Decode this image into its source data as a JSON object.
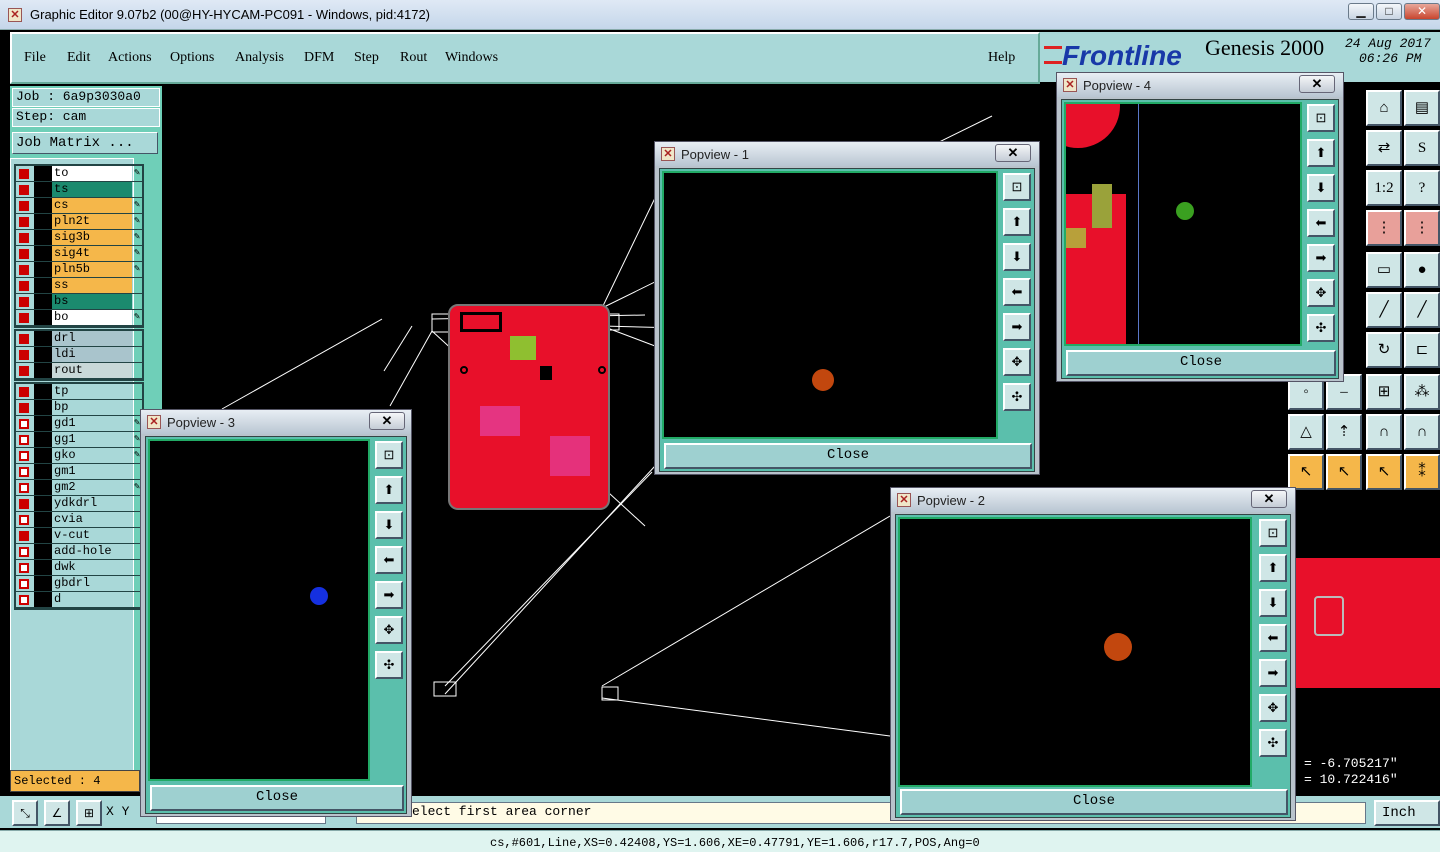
{
  "window": {
    "title": "Graphic Editor 9.07b2 (00@HY-HYCAM-PC091 - Windows, pid:4172)",
    "min": "▁",
    "max": "□",
    "close": "✕"
  },
  "menu": {
    "items": [
      "File",
      "Edit",
      "Actions",
      "Options",
      "Analysis",
      "DFM",
      "Step",
      "Rout",
      "Windows"
    ],
    "help": "Help"
  },
  "logo": {
    "brand": "Frontline",
    "product": "Genesis 2000",
    "date": "24 Aug 2017",
    "time": "06:26 PM"
  },
  "job": {
    "job_label": "Job : 6a9p3030a0",
    "step_label": "Step: cam",
    "matrix_button": "Job Matrix ..."
  },
  "layers_group1": [
    {
      "name": "to",
      "color": "#ffffff",
      "on": true,
      "pen": true
    },
    {
      "name": "ts",
      "color": "#1b8a6e",
      "on": true,
      "pen": false
    },
    {
      "name": "cs",
      "color": "#f5b74a",
      "on": true,
      "pen": true
    },
    {
      "name": "pln2t",
      "color": "#f5b74a",
      "on": true,
      "pen": true
    },
    {
      "name": "sig3b",
      "color": "#f5b74a",
      "on": true,
      "pen": true
    },
    {
      "name": "sig4t",
      "color": "#f5b74a",
      "on": true,
      "pen": true
    },
    {
      "name": "pln5b",
      "color": "#f5b74a",
      "on": true,
      "pen": true
    },
    {
      "name": "ss",
      "color": "#f5b74a",
      "on": true,
      "pen": false
    },
    {
      "name": "bs",
      "color": "#1b8a6e",
      "on": true,
      "pen": false
    },
    {
      "name": "bo",
      "color": "#ffffff",
      "on": true,
      "pen": true
    }
  ],
  "layers_group2": [
    {
      "name": "drl",
      "color": "#a9c4cc",
      "on": true,
      "pen": false
    },
    {
      "name": "ldi",
      "color": "#a9c4cc",
      "on": true,
      "pen": false
    },
    {
      "name": "rout",
      "color": "#c8d8d8",
      "on": true,
      "pen": false
    }
  ],
  "layers_group3": [
    {
      "name": "tp",
      "color": "#a9d8d8",
      "on": true,
      "pen": false
    },
    {
      "name": "bp",
      "color": "#a9d8d8",
      "on": true,
      "pen": false
    },
    {
      "name": "gd1",
      "color": "#a9d8d8",
      "on": false,
      "pen": true
    },
    {
      "name": "gg1",
      "color": "#a9d8d8",
      "on": false,
      "pen": true
    },
    {
      "name": "gko",
      "color": "#a9d8d8",
      "on": false,
      "pen": true
    },
    {
      "name": "gm1",
      "color": "#a9d8d8",
      "on": false,
      "pen": false
    },
    {
      "name": "gm2",
      "color": "#a9d8d8",
      "on": false,
      "pen": true
    },
    {
      "name": "ydkdrl",
      "color": "#a9d8d8",
      "on": true,
      "pen": false
    },
    {
      "name": "cvia",
      "color": "#a9d8d8",
      "on": false,
      "pen": false
    },
    {
      "name": "v-cut",
      "color": "#a9d8d8",
      "on": true,
      "pen": false
    },
    {
      "name": "add-hole",
      "color": "#a9d8d8",
      "on": false,
      "pen": false
    },
    {
      "name": "dwk",
      "color": "#a9d8d8",
      "on": false,
      "pen": false
    },
    {
      "name": "gbdrl",
      "color": "#a9d8d8",
      "on": false,
      "pen": false
    },
    {
      "name": "d",
      "color": "#a9d8d8",
      "on": false,
      "pen": false
    }
  ],
  "selected": "Selected : 4",
  "popviews": {
    "p1": {
      "title": "Popview - 1",
      "close": "Close",
      "dot_color": "#c2470e"
    },
    "p2": {
      "title": "Popview - 2",
      "close": "Close",
      "dot_color": "#c2470e"
    },
    "p3": {
      "title": "Popview - 3",
      "close": "Close",
      "dot_color": "#1530e0"
    },
    "p4": {
      "title": "Popview - 4",
      "close": "Close",
      "dot_color": "#3aa020"
    },
    "close_x": "✕"
  },
  "coords": {
    "x": "= -6.705217\"",
    "y": "= 10.722416\""
  },
  "status": {
    "xy": "X Y",
    "prompt": "elect first area corner",
    "units": "Inch"
  },
  "bottom": "cs,#601,Line,XS=0.42408,YS=1.606,XE=0.47791,YE=1.606,r17.7,POS,Ang=0",
  "colors": {
    "panel": "#a9d8d8",
    "accent": "#5bbfac",
    "board": "#e8102a"
  }
}
